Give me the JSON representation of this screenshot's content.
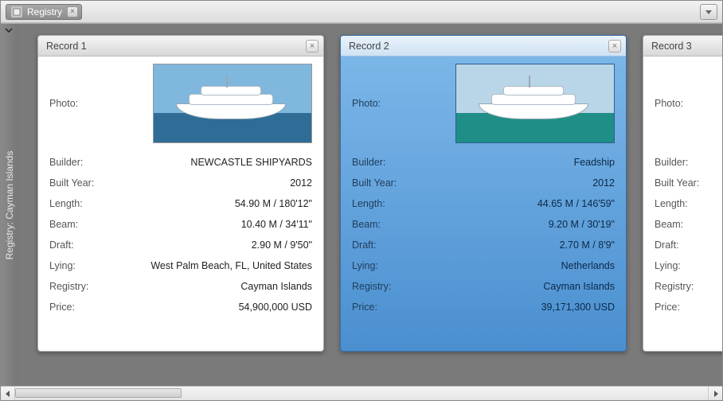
{
  "topbar": {
    "tab_label": "Registry"
  },
  "sidebar": {
    "title": "Registry: Cayman Islands"
  },
  "fields": {
    "photo": "Photo:",
    "builder": "Builder:",
    "built_year": "Built Year:",
    "length": "Length:",
    "beam": "Beam:",
    "draft": "Draft:",
    "lying": "Lying:",
    "registry": "Registry:",
    "price": "Price:"
  },
  "records": [
    {
      "title": "Record 1",
      "selected": false,
      "photo_palette": {
        "sky": "#7fb7dd",
        "sea": "#2f6d97"
      },
      "builder": "NEWCASTLE SHIPYARDS",
      "built_year": "2012",
      "length": "54.90 M / 180'12\"",
      "beam": "10.40 M / 34'11\"",
      "draft": "2.90 M / 9'50\"",
      "lying": "West Palm Beach, FL, United States",
      "registry": "Cayman Islands",
      "price": "54,900,000 USD"
    },
    {
      "title": "Record 2",
      "selected": true,
      "photo_palette": {
        "sky": "#b9d6e8",
        "sea": "#1f8e86"
      },
      "builder": "Feadship",
      "built_year": "2012",
      "length": "44.65 M / 146'59\"",
      "beam": "9.20 M / 30'19\"",
      "draft": "2.70 M / 8'9\"",
      "lying": "Netherlands",
      "registry": "Cayman Islands",
      "price": "39,171,300 USD"
    },
    {
      "title": "Record 3",
      "selected": false,
      "clipped": true,
      "builder": "",
      "built_year": "",
      "length": "",
      "beam": "",
      "draft": "",
      "lying": "",
      "registry": "",
      "price": ""
    }
  ]
}
